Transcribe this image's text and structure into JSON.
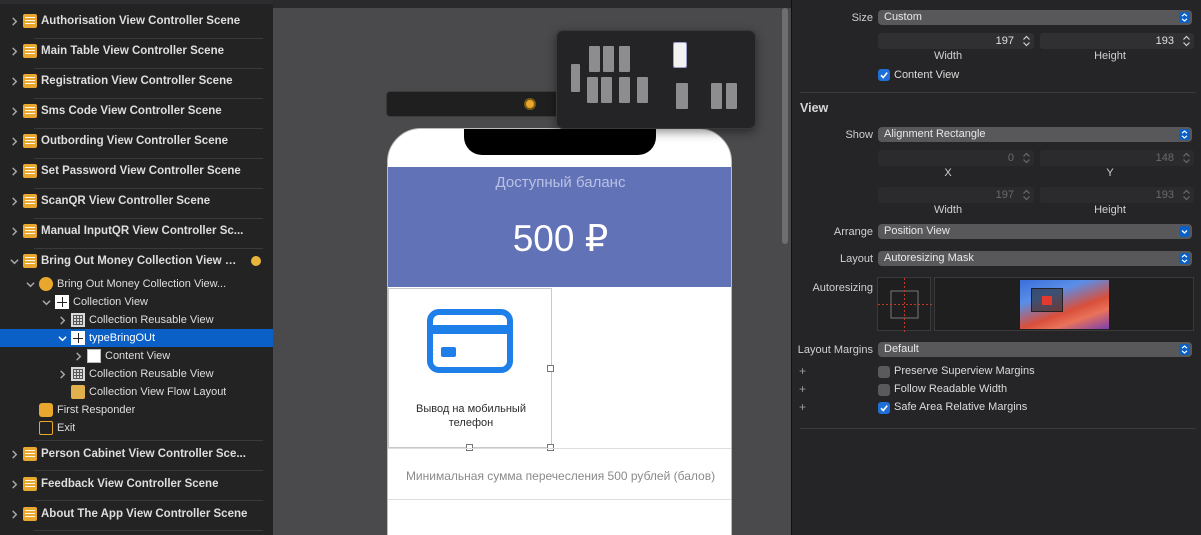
{
  "outline": {
    "scenes": [
      "Authorisation View Controller Scene",
      "Main Table View Controller Scene",
      "Registration View Controller Scene",
      "Sms Code View Controller Scene",
      "Outbording View Controller Scene",
      "Set Password View Controller Scene",
      "ScanQR View Controller Scene",
      "Manual InputQR View Controller Sc...",
      "Bring Out Money Collection View C..."
    ],
    "expanded": {
      "controller": "Bring Out Money Collection View...",
      "collection_view": "Collection View",
      "reusable_1": "Collection Reusable View",
      "selected_cell": "typeBringOUt",
      "content_view": "Content View",
      "reusable_2": "Collection Reusable View",
      "flow_layout": "Collection View Flow Layout",
      "first_responder": "First Responder",
      "exit": "Exit"
    },
    "scenes_after": [
      "Person Cabinet View Controller Sce...",
      "Feedback View Controller Scene",
      "About The App View Controller Scene"
    ]
  },
  "canvas": {
    "balance_label": "Доступный баланс",
    "balance_value": "500 ₽",
    "cell_label": "Вывод на мобильный телефон",
    "min_text": "Минимальная сумма перечесления 500 рублей (балов)",
    "header_color": "#6272b6",
    "icon_color": "#1f7fe8"
  },
  "inspector": {
    "size_label": "Size",
    "size_value": "Custom",
    "width_value": "197",
    "height_value": "193",
    "width_label": "Width",
    "height_label": "Height",
    "content_view_label": "Content View",
    "view_section": "View",
    "show_label": "Show",
    "show_value": "Alignment Rectangle",
    "x_value": "0",
    "y_value": "148",
    "x_label": "X",
    "y_label": "Y",
    "w2_value": "197",
    "h2_value": "193",
    "w2_label": "Width",
    "h2_label": "Height",
    "arrange_label": "Arrange",
    "arrange_value": "Position View",
    "layout_label": "Layout",
    "layout_value": "Autoresizing Mask",
    "autoresizing_label": "Autoresizing",
    "layout_margins_label": "Layout Margins",
    "layout_margins_value": "Default",
    "preserve_label": "Preserve Superview Margins",
    "readable_label": "Follow Readable Width",
    "safe_area_label": "Safe Area Relative Margins",
    "plus": "+"
  }
}
